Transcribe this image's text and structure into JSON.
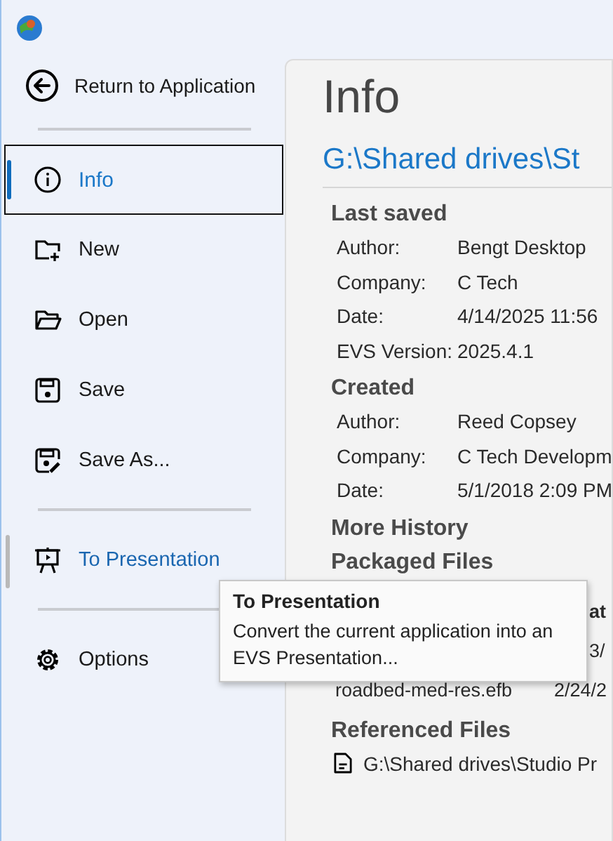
{
  "sidebar": {
    "back": {
      "label": "Return to Application"
    },
    "groups": [
      [
        {
          "label": "Info",
          "kind": "info",
          "selected": true,
          "hover": false
        },
        {
          "label": "New",
          "kind": "new",
          "selected": false,
          "hover": false
        },
        {
          "label": "Open",
          "kind": "open",
          "selected": false,
          "hover": false
        },
        {
          "label": "Save",
          "kind": "save",
          "selected": false,
          "hover": false
        },
        {
          "label": "Save As...",
          "kind": "saveas",
          "selected": false,
          "hover": false
        }
      ],
      [
        {
          "label": "To Presentation",
          "kind": "presentation",
          "selected": false,
          "hover": true
        }
      ],
      [
        {
          "label": "Options",
          "kind": "options",
          "selected": false,
          "hover": false
        }
      ]
    ]
  },
  "main": {
    "title": "Info",
    "path": "G:\\Shared drives\\St",
    "sections": [
      {
        "title": "Last saved",
        "rows": [
          {
            "label": "Author:",
            "value": "Bengt Desktop"
          },
          {
            "label": "Company:",
            "value": "C Tech"
          },
          {
            "label": "Date:",
            "value": "4/14/2025 11:56"
          },
          {
            "label": "EVS Version:",
            "value": "2025.4.1"
          }
        ]
      },
      {
        "title": "Created",
        "rows": [
          {
            "label": "Author:",
            "value": "Reed Copsey"
          },
          {
            "label": "Company:",
            "value": "C Tech Developm"
          },
          {
            "label": "Date:",
            "value": "5/1/2018 2:09 PM"
          }
        ]
      },
      {
        "title": "More History"
      }
    ],
    "packaged": {
      "title": "Packaged Files",
      "column_2": "at",
      "rows": [
        {
          "date": "3/"
        },
        {
          "name": "roadbed-med-res.efb",
          "date": "2/24/2"
        }
      ]
    },
    "referenced": {
      "title": "Referenced Files",
      "files": [
        "G:\\Shared drives\\Studio Pr"
      ]
    }
  },
  "tooltip": {
    "title": "To Presentation",
    "text": "Convert the current application into an EVS Presentation..."
  }
}
